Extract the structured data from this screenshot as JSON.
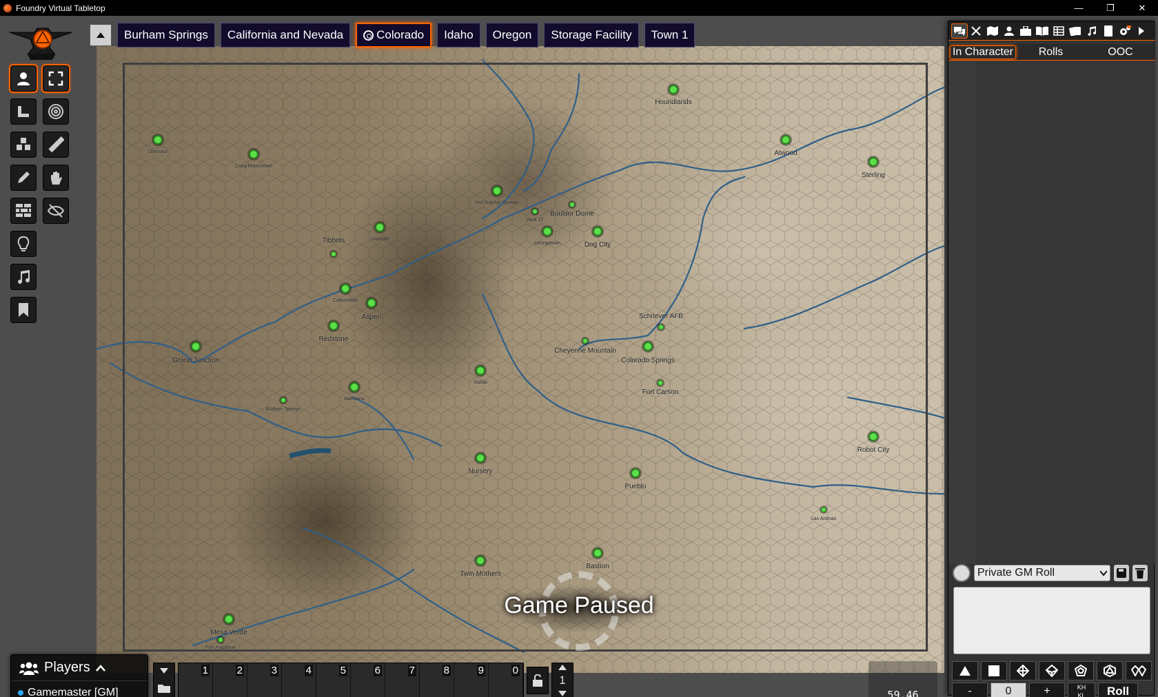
{
  "window": {
    "title": "Foundry Virtual Tabletop",
    "buttons": [
      "—",
      "❐",
      "✕"
    ]
  },
  "scene_nav": {
    "toggle_icon": "caret-up-icon",
    "scenes": [
      {
        "label": "Burham Springs",
        "active": false
      },
      {
        "label": "California and Nevada",
        "active": false
      },
      {
        "label": "Colorado",
        "active": true
      },
      {
        "label": "Idaho",
        "active": false
      },
      {
        "label": "Oregon",
        "active": false
      },
      {
        "label": "Storage Facility",
        "active": false
      },
      {
        "label": "Town 1",
        "active": false
      }
    ]
  },
  "controls": [
    {
      "name": "token-controls",
      "icon": "user-icon",
      "active": true
    },
    {
      "name": "fullscreen-tool",
      "icon": "expand-icon",
      "active": true
    },
    {
      "name": "measure-controls",
      "icon": "ruler-square-icon",
      "active": false
    },
    {
      "name": "target-tool",
      "icon": "bullseye-icon",
      "active": false
    },
    {
      "name": "tile-controls",
      "icon": "cubes-icon",
      "active": false
    },
    {
      "name": "ruler-tool",
      "icon": "ruler-icon",
      "active": false
    },
    {
      "name": "drawing-controls",
      "icon": "pencil-icon",
      "active": false
    },
    {
      "name": "hand-tool",
      "icon": "hand-icon",
      "active": false
    },
    {
      "name": "wall-controls",
      "icon": "brick-wall-icon",
      "active": false
    },
    {
      "name": "hide-tool",
      "icon": "eye-slash-icon",
      "active": false
    },
    {
      "name": "lighting-controls",
      "icon": "lightbulb-icon",
      "active": false
    },
    {
      "name": "sound-controls",
      "icon": "music-icon",
      "active": false
    },
    {
      "name": "notes-controls",
      "icon": "bookmark-icon",
      "active": false
    }
  ],
  "map": {
    "locations": [
      {
        "name": "Houndlands",
        "size": "large"
      },
      {
        "name": "Atwood",
        "size": "large"
      },
      {
        "name": "Sterling",
        "size": "large"
      },
      {
        "name": "Dinosaur",
        "size": "small"
      },
      {
        "name": "Craig/Moonstown",
        "size": "small"
      },
      {
        "name": "Hot Sulphur Springs",
        "size": "small"
      },
      {
        "name": "Vault 27",
        "size": "small"
      },
      {
        "name": "Boulder Dome",
        "size": "large"
      },
      {
        "name": "Georgetown",
        "size": "small"
      },
      {
        "name": "Dog City",
        "size": "large"
      },
      {
        "name": "Leadville",
        "size": "small"
      },
      {
        "name": "Tibbets",
        "size": "large"
      },
      {
        "name": "Carbondale",
        "size": "small"
      },
      {
        "name": "Aspen",
        "size": "large"
      },
      {
        "name": "Redstone",
        "size": "large"
      },
      {
        "name": "Grand Junction",
        "size": "large"
      },
      {
        "name": "Schriever AFB",
        "size": "large"
      },
      {
        "name": "Cheyenne Mountain",
        "size": "large"
      },
      {
        "name": "Colorado Springs",
        "size": "large"
      },
      {
        "name": "Salida",
        "size": "small"
      },
      {
        "name": "Fort Carson",
        "size": "large"
      },
      {
        "name": "Marmaria",
        "size": "small"
      },
      {
        "name": "Burham Springs",
        "size": "small"
      },
      {
        "name": "Robot City",
        "size": "large"
      },
      {
        "name": "Nursery",
        "size": "large"
      },
      {
        "name": "Pueblo",
        "size": "large"
      },
      {
        "name": "Las Animas",
        "size": "small"
      },
      {
        "name": "Bastion",
        "size": "large"
      },
      {
        "name": "Twin Mothers",
        "size": "large"
      },
      {
        "name": "Mesa Verde",
        "size": "large"
      },
      {
        "name": "Fort Arapahoe",
        "size": "small"
      }
    ]
  },
  "paused": {
    "text": "Game Paused"
  },
  "sidebar": {
    "tabs": [
      {
        "name": "chat",
        "icon": "comments-icon"
      },
      {
        "name": "combat",
        "icon": "swords-icon"
      },
      {
        "name": "scenes",
        "icon": "map-icon"
      },
      {
        "name": "actors",
        "icon": "user-icon"
      },
      {
        "name": "items",
        "icon": "suitcase-icon"
      },
      {
        "name": "journal",
        "icon": "book-open-icon"
      },
      {
        "name": "tables",
        "icon": "table-icon"
      },
      {
        "name": "cards",
        "icon": "cards-icon"
      },
      {
        "name": "playlists",
        "icon": "music-icon"
      },
      {
        "name": "compendium",
        "icon": "atlas-icon"
      },
      {
        "name": "settings",
        "icon": "cogs-icon"
      },
      {
        "name": "collapse",
        "icon": "caret-right-icon"
      }
    ],
    "chat_modes": [
      "In Character",
      "Rolls",
      "OOC"
    ],
    "roll_mode": "Private GM Roll",
    "dice": [
      "d4",
      "d6",
      "d8",
      "d10",
      "d12",
      "d20",
      "d100"
    ],
    "roll_controls": {
      "minus": "-",
      "count": "0",
      "plus": "+",
      "kh": "KH",
      "kl": "KL",
      "roll": "Roll"
    }
  },
  "players": {
    "title": "Players",
    "list": [
      {
        "name": "Gamemaster [GM]",
        "color": "#2aa8ff"
      }
    ]
  },
  "hotbar": {
    "slots": [
      "1",
      "2",
      "3",
      "4",
      "5",
      "6",
      "7",
      "8",
      "9",
      "0"
    ],
    "page": "1"
  },
  "fps": {
    "value": "59.46"
  }
}
